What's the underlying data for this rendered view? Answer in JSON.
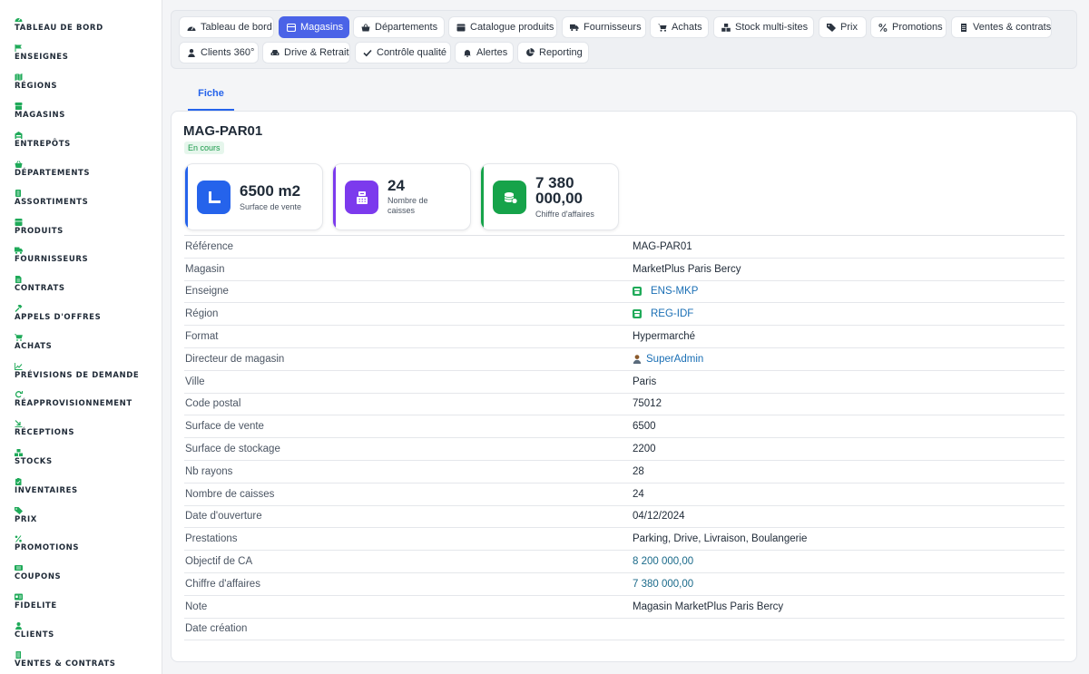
{
  "sidebar": {
    "items": [
      {
        "label": "TABLEAU DE BORD",
        "icon": "dashboard-icon"
      },
      {
        "label": "ENSEIGNES",
        "icon": "flag-icon"
      },
      {
        "label": "RÉGIONS",
        "icon": "map-icon"
      },
      {
        "label": "MAGASINS",
        "icon": "store-icon"
      },
      {
        "label": "ENTREPÔTS",
        "icon": "warehouse-icon"
      },
      {
        "label": "DÉPARTEMENTS",
        "icon": "basket-icon"
      },
      {
        "label": "ASSORTIMENTS",
        "icon": "list-icon"
      },
      {
        "label": "PRODUITS",
        "icon": "box-icon"
      },
      {
        "label": "FOURNISSEURS",
        "icon": "truck-icon"
      },
      {
        "label": "CONTRATS",
        "icon": "contract-icon"
      },
      {
        "label": "APPELS D'OFFRES",
        "icon": "gavel-icon"
      },
      {
        "label": "ACHATS",
        "icon": "cart-icon"
      },
      {
        "label": "PRÉVISIONS DE DEMANDE",
        "icon": "chart-icon"
      },
      {
        "label": "RÉAPPROVISIONNEMENT",
        "icon": "refresh-icon"
      },
      {
        "label": "RÉCEPTIONS",
        "icon": "receive-icon"
      },
      {
        "label": "STOCKS",
        "icon": "boxes-icon"
      },
      {
        "label": "INVENTAIRES",
        "icon": "clipboard-icon"
      },
      {
        "label": "PRIX",
        "icon": "tag-icon"
      },
      {
        "label": "PROMOTIONS",
        "icon": "percent-icon"
      },
      {
        "label": "COUPONS",
        "icon": "ticket-icon"
      },
      {
        "label": "FIDELITE",
        "icon": "card-icon"
      },
      {
        "label": "CLIENTS",
        "icon": "user-icon"
      },
      {
        "label": "VENTES & CONTRATS",
        "icon": "receipt-icon"
      }
    ]
  },
  "topnav": {
    "items": [
      {
        "label": "Tableau de bord",
        "icon": "dashboard-icon",
        "active": false
      },
      {
        "label": "Magasins",
        "icon": "store-icon",
        "active": true
      },
      {
        "label": "Départements",
        "icon": "basket-icon",
        "active": false
      },
      {
        "label": "Catalogue produits",
        "icon": "catalog-icon",
        "active": false
      },
      {
        "label": "Fournisseurs",
        "icon": "truck-icon",
        "active": false
      },
      {
        "label": "Achats",
        "icon": "cart-icon",
        "active": false
      },
      {
        "label": "Stock multi-sites",
        "icon": "boxes-icon",
        "active": false
      },
      {
        "label": "Prix",
        "icon": "tag-icon",
        "active": false
      },
      {
        "label": "Promotions",
        "icon": "percent-icon",
        "active": false
      },
      {
        "label": "Ventes & contrats",
        "icon": "receipt-icon",
        "active": false
      },
      {
        "label": "Clients 360°",
        "icon": "user-icon",
        "active": false
      },
      {
        "label": "Drive & Retrait",
        "icon": "car-icon",
        "active": false
      },
      {
        "label": "Contrôle qualité",
        "icon": "check-icon",
        "active": false
      },
      {
        "label": "Alertes",
        "icon": "bell-icon",
        "active": false
      },
      {
        "label": "Reporting",
        "icon": "pie-icon",
        "active": false
      }
    ]
  },
  "tab": {
    "label": "Fiche"
  },
  "record": {
    "title": "MAG-PAR01",
    "status": "En cours"
  },
  "stats": [
    {
      "value": "6500 m2",
      "label": "Surface de vente",
      "icon": "ruler-icon",
      "color": "#2563eb"
    },
    {
      "value": "24",
      "label": "Nombre de caisses",
      "icon": "cash-register-icon",
      "color": "#7c3aed"
    },
    {
      "value": "7 380 000,00",
      "label": "Chiffre d'affaires",
      "icon": "coins-icon",
      "color": "#16a34a"
    }
  ],
  "details": [
    {
      "label": "Référence",
      "value": "MAG-PAR01",
      "kind": "text"
    },
    {
      "label": "Magasin",
      "value": "MarketPlus Paris Bercy",
      "kind": "text"
    },
    {
      "label": "Enseigne",
      "value": "ENS-MKP",
      "kind": "link",
      "icon": "store-icon"
    },
    {
      "label": "Région",
      "value": "REG-IDF",
      "kind": "link",
      "icon": "store-icon"
    },
    {
      "label": "Format",
      "value": "Hypermarché",
      "kind": "text"
    },
    {
      "label": "Directeur de magasin",
      "value": "SuperAdmin",
      "kind": "link",
      "icon": "user-icon"
    },
    {
      "label": "Ville",
      "value": "Paris",
      "kind": "text"
    },
    {
      "label": "Code postal",
      "value": "75012",
      "kind": "text"
    },
    {
      "label": "Surface de vente",
      "value": "6500",
      "kind": "text"
    },
    {
      "label": "Surface de stockage",
      "value": "2200",
      "kind": "text"
    },
    {
      "label": "Nb rayons",
      "value": "28",
      "kind": "text"
    },
    {
      "label": "Nombre de caisses",
      "value": "24",
      "kind": "text"
    },
    {
      "label": "Date d'ouverture",
      "value": "04/12/2024",
      "kind": "text"
    },
    {
      "label": "Prestations",
      "value": "Parking, Drive, Livraison, Boulangerie",
      "kind": "text"
    },
    {
      "label": "Objectif de CA",
      "value": "8 200 000,00",
      "kind": "money"
    },
    {
      "label": "Chiffre d'affaires",
      "value": "7 380 000,00",
      "kind": "money"
    },
    {
      "label": "Note",
      "value": "Magasin MarketPlus Paris Bercy",
      "kind": "text"
    },
    {
      "label": "Date création",
      "value": "",
      "kind": "text"
    }
  ]
}
